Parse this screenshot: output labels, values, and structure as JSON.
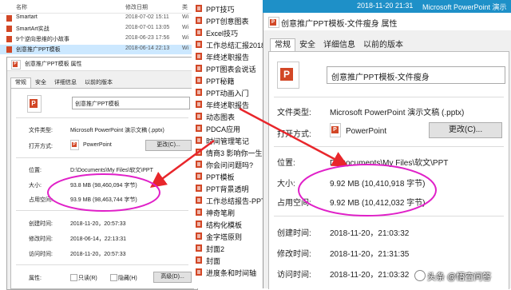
{
  "explorer": {
    "headers": [
      "名称",
      "修改日期",
      "类"
    ],
    "rows": [
      {
        "name": "Smartart",
        "date": "2018-07-02 15:11",
        "type": "Wi",
        "selected": false
      },
      {
        "name": "SmartArt实战",
        "date": "2018-07-01 13:05",
        "type": "Wi",
        "selected": false
      },
      {
        "name": "9个逆向思维的小故事",
        "date": "2018-06-23 17:56",
        "type": "Wi",
        "selected": false
      },
      {
        "name": "创意推广PPT模板",
        "date": "2018-06-14 22:13",
        "type": "Wi",
        "selected": true
      }
    ]
  },
  "left_dialog": {
    "title": "创意推广PPT模板 属性",
    "tabs": [
      "常规",
      "安全",
      "详细信息",
      "以前的版本"
    ],
    "filename": "创意推广PPT模板",
    "file_type_label": "文件类型:",
    "file_type_value": "Microsoft PowerPoint 演示文稿 (.pptx)",
    "open_with_label": "打开方式:",
    "open_with_value": "PowerPoint",
    "change_button": "更改(C)...",
    "location_label": "位置:",
    "location_value": "D:\\Documents\\My Files\\软文\\PPT",
    "size_label": "大小:",
    "size_value": "93.8 MB (98,460,094 字节)",
    "disk_label": "占用空间:",
    "disk_value": "93.9 MB (98,463,744 字节)",
    "created_label": "创建时间:",
    "created_value": "2018-11-20，20:57:33",
    "modified_label": "修改时间:",
    "modified_value": "2018-06-14，22:13:31",
    "accessed_label": "访问时间:",
    "accessed_value": "2018-11-20，20:57:33",
    "attrs_label": "属性:",
    "readonly_label": "只读(R)",
    "hidden_label": "隐藏(H)",
    "advanced_button": "高级(D)..."
  },
  "mid_list": [
    "PPT技巧",
    "PPT创意图表",
    "Excel技巧",
    "工作总结汇报2018",
    "年终述职报告",
    "PPT图表会说话",
    "PPT秘籍",
    "PPT动画入门",
    "年终述职报告",
    "动态图表",
    "PDCA应用",
    "时间管理笔记",
    "情商3 影响你一生",
    "你会问问题吗?",
    "PPT模板",
    "PPT背景透明",
    "工作总结报告-PPT",
    "神奇笔刷",
    "结构化模板",
    "金字塔原则",
    "封面2",
    "封面",
    "进度条和时间轴"
  ],
  "titlebar": {
    "date": "2018-11-20 21:31",
    "app": "Microsoft PowerPoint 演示"
  },
  "right_dialog": {
    "title": "创意推广PPT模板-文件瘦身 属性",
    "tabs": [
      "常规",
      "安全",
      "详细信息",
      "以前的版本"
    ],
    "filename": "创意推广PPT模板-文件瘦身",
    "file_type_label": "文件类型:",
    "file_type_value": "Microsoft PowerPoint 演示文稿 (.pptx)",
    "open_with_label": "打开方式:",
    "open_with_value": "PowerPoint",
    "change_button": "更改(C)...",
    "location_label": "位置:",
    "location_value": "D:\\Documents\\My Files\\软文\\PPT",
    "size_label": "大小:",
    "size_value": "9.92 MB (10,410,918 字节)",
    "disk_label": "占用空间:",
    "disk_value": "9.92 MB (10,412,032 字节)",
    "created_label": "创建时间:",
    "created_value": "2018-11-20，21:03:32",
    "modified_label": "修改时间:",
    "modified_value": "2018-11-20，21:31:35",
    "accessed_label": "访问时间:",
    "accessed_value": "2018-11-20，21:03:32"
  },
  "watermark": "头条 @悟空问答",
  "colors": {
    "highlight_ellipse": "#e020c8",
    "arrow": "#e8262b",
    "titlebar": "#1e90c8",
    "ppt_red": "#d24726",
    "selection": "#cce8ff"
  }
}
